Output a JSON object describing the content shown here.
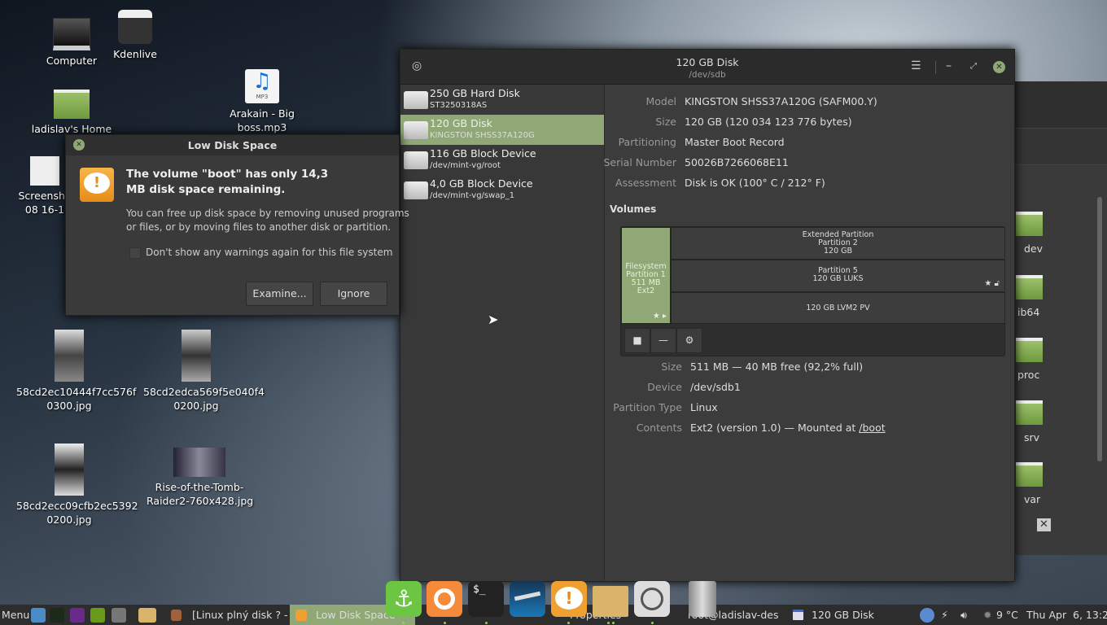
{
  "desktop": {
    "icons": [
      {
        "label": "Computer",
        "icon": "monitor-icon"
      },
      {
        "label": "Kdenlive",
        "icon": "clapperboard-icon"
      },
      {
        "label": "ladislav's Home",
        "icon": "home-folder-icon"
      },
      {
        "label": "Screensho\n08 16-1",
        "icon": "screenshot-thumbnail"
      },
      {
        "label": "Arakain - Big boss.mp3",
        "icon": "mp3-file-icon",
        "badge": "MP3"
      },
      {
        "label": "58cd2ec10444f7cc576f\n0300.jpg",
        "icon": "image-thumbnail"
      },
      {
        "label": "58cd2edca569f5e040f4\n0200.jpg",
        "icon": "image-thumbnail"
      },
      {
        "label": "58cd2ecc09cfb2ec5392\n0200.jpg",
        "icon": "image-thumbnail"
      },
      {
        "label": "Rise-of-the-Tomb-\nRaider2-760x428.jpg",
        "icon": "image-thumbnail"
      }
    ]
  },
  "file_manager": {
    "folders": [
      "dev",
      "ib64",
      "proc",
      "srv",
      "var"
    ]
  },
  "disks": {
    "title": "120 GB Disk",
    "subtitle": "/dev/sdb",
    "devices": [
      {
        "name": "250 GB Hard Disk",
        "sub": "ST3250318AS",
        "selected": false
      },
      {
        "name": "120 GB Disk",
        "sub": "KINGSTON SHSS37A120G",
        "selected": true
      },
      {
        "name": "116 GB Block Device",
        "sub": "/dev/mint-vg/root",
        "selected": false
      },
      {
        "name": "4,0 GB Block Device",
        "sub": "/dev/mint-vg/swap_1",
        "selected": false
      }
    ],
    "info": [
      {
        "k": "Model",
        "v": "KINGSTON SHSS37A120G (SAFM00.Y)"
      },
      {
        "k": "Size",
        "v": "120 GB (120 034 123 776 bytes)"
      },
      {
        "k": "Partitioning",
        "v": "Master Boot Record"
      },
      {
        "k": "Serial Number",
        "v": "50026B7266068E11"
      },
      {
        "k": "Assessment",
        "v": "Disk is OK (100° C / 212° F)"
      }
    ],
    "volumes_label": "Volumes",
    "partitions": {
      "p1": [
        "Filesystem",
        "Partition 1",
        "511 MB Ext2"
      ],
      "ext": [
        "Extended Partition",
        "Partition 2",
        "120 GB"
      ],
      "p5": [
        "Partition 5",
        "120 GB LUKS"
      ],
      "lvm": [
        "120 GB LVM2 PV"
      ]
    },
    "details": [
      {
        "k": "Size",
        "v": "511 MB — 40 MB free (92,2% full)"
      },
      {
        "k": "Device",
        "v": "/dev/sdb1"
      },
      {
        "k": "Partition Type",
        "v": "Linux"
      },
      {
        "k": "Contents",
        "v": "Ext2 (version 1.0) — Mounted at ",
        "link": "/boot"
      }
    ]
  },
  "dialog": {
    "title": "Low Disk Space",
    "heading": "The volume \"boot\" has only 14,3\nMB disk space remaining.",
    "body": "You can free up disk space by removing unused programs\nor files, or by moving files to another disk or partition.",
    "checkbox": "Don't show any warnings again for this file system",
    "checked": false,
    "examine": "Examine...",
    "ignore": "Ignore"
  },
  "taskbar": {
    "menu": "Menu",
    "items": [
      "[Linux plný disk ? -...",
      "Low Disk Space",
      "Properties",
      "root@ladislav-des...",
      "120 GB Disk"
    ],
    "temp": "9 °C",
    "clock": "Thu Apr  6, 13:25"
  },
  "colors": {
    "accent": "#8fa876",
    "warning": "#f0a030"
  }
}
